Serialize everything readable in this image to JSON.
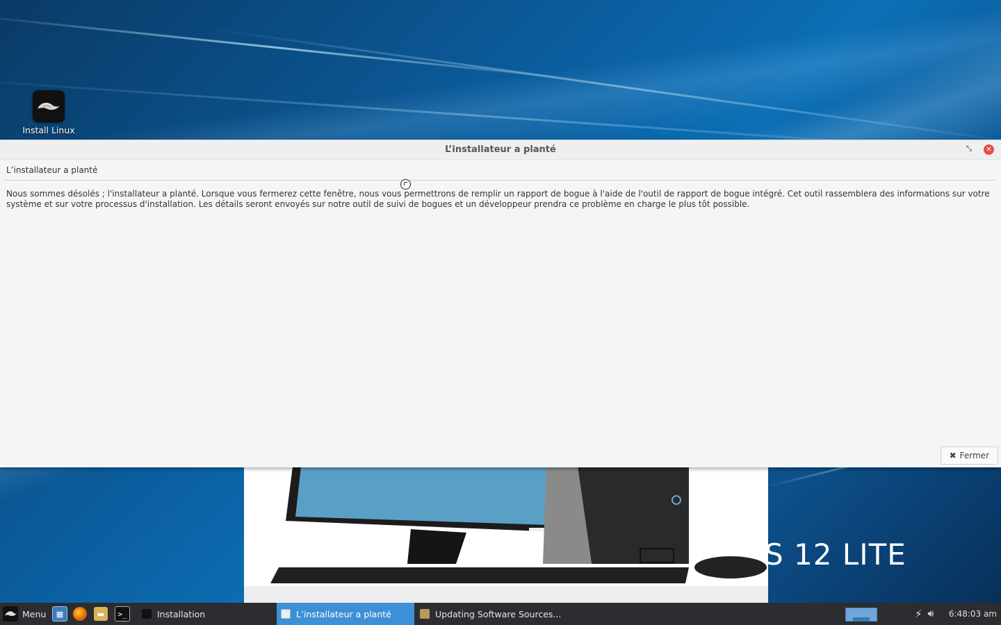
{
  "desktop": {
    "icons": [
      {
        "label": "Install Linux"
      }
    ],
    "brand_text": "S 12 LITE"
  },
  "dialog": {
    "title": "L’installateur a planté",
    "header": "L’installateur a planté",
    "message": "Nous sommes désolés ; l'installateur a planté. Lorsque vous fermerez cette fenêtre, nous vous permettrons de remplir un rapport de bogue à l'aide de l'outil de rapport de bogue intégré. Cet outil rassemblera des informations sur votre système et sur votre processus d'installation. Les détails seront envoyés sur notre outil de suivi de bogues et un développeur prendra ce problème en charge le plus tôt possible.",
    "close_button": "Fermer",
    "close_icon": "✖"
  },
  "taskbar": {
    "menu_label": "Menu",
    "launchers": [
      "show-desktop-icon",
      "firefox-icon",
      "files-icon",
      "terminal-icon"
    ],
    "tasks": [
      {
        "label": "Installation",
        "active": false
      },
      {
        "label": "L’installateur a planté",
        "active": true
      },
      {
        "label": "Updating Software Sources...",
        "active": false
      }
    ],
    "clock": "6:48:03 am"
  },
  "colors": {
    "accent": "#3d8fd6",
    "close_red": "#e94b4b",
    "taskbar_bg": "#2b2d30"
  }
}
